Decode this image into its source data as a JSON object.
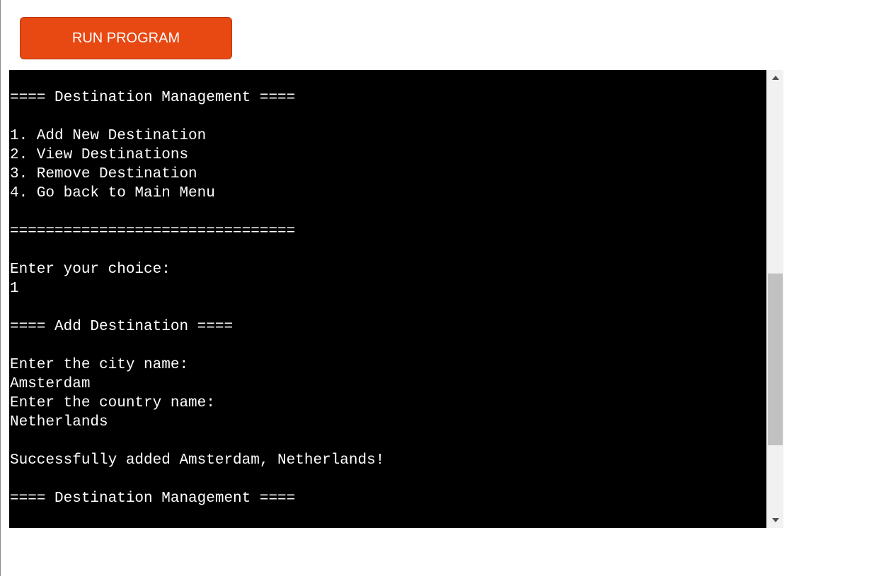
{
  "run_button": {
    "label": "RUN PROGRAM",
    "color": "#e84812"
  },
  "terminal": {
    "background": "#000000",
    "text_color": "#ffffff",
    "lines": [
      "==== Destination Management ====",
      "",
      "1. Add New Destination",
      "2. View Destinations",
      "3. Remove Destination",
      "4. Go back to Main Menu",
      "",
      "================================",
      "",
      "Enter your choice:",
      "1",
      "",
      "==== Add Destination ====",
      "",
      "Enter the city name:",
      "Amsterdam",
      "Enter the country name:",
      "Netherlands",
      "",
      "Successfully added Amsterdam, Netherlands!",
      "",
      "==== Destination Management ===="
    ]
  },
  "scrollbar": {
    "up_icon": "chevron-up-icon",
    "down_icon": "chevron-down-icon"
  }
}
